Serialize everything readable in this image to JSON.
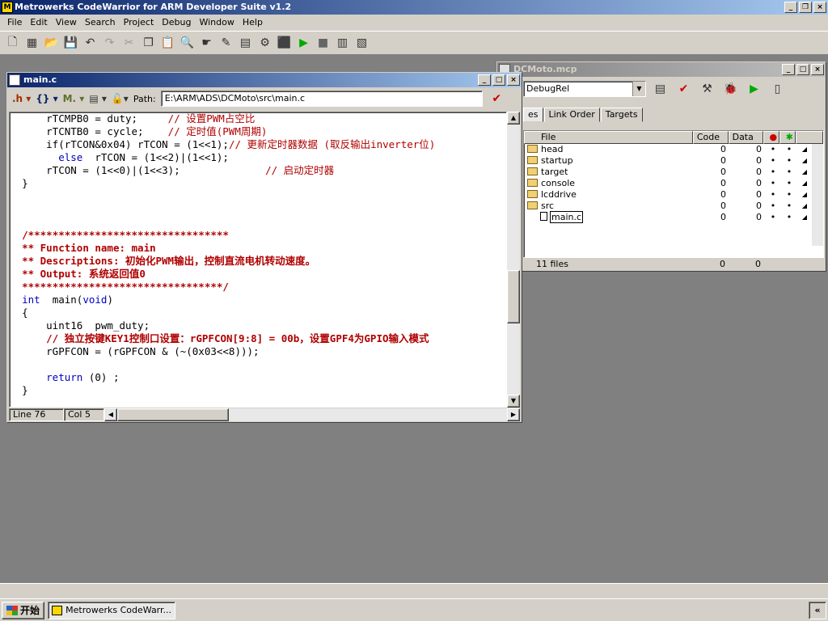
{
  "app": {
    "title": "Metrowerks CodeWarrior for ARM Developer Suite v1.2"
  },
  "menu": [
    "File",
    "Edit",
    "View",
    "Search",
    "Project",
    "Debug",
    "Window",
    "Help"
  ],
  "toolbar_icons": [
    "new-text-file-icon",
    "new-project-icon",
    "open-icon",
    "save-icon",
    "undo-icon",
    "redo-icon",
    "cut-icon",
    "copy-icon",
    "paste-icon",
    "find-icon",
    "find-next-icon",
    "replace-icon",
    "compile-icon",
    "project-settings-icon",
    "check-syntax-icon",
    "bring-up-to-date-icon",
    "debug-icon",
    "stop-icon",
    "preprocess-icon",
    "disassemble-icon"
  ],
  "project_window": {
    "title": "DCMoto.mcp",
    "target": "DebugRel",
    "tabs": [
      "es",
      "Link Order",
      "Targets"
    ],
    "columns": {
      "file": "File",
      "code": "Code",
      "data": "Data"
    },
    "files": [
      {
        "name": "head",
        "type": "folder",
        "code": "0",
        "data": "0",
        "debug": "•",
        "target": "•"
      },
      {
        "name": "startup",
        "type": "folder",
        "code": "0",
        "data": "0",
        "debug": "•",
        "target": "•"
      },
      {
        "name": "target",
        "type": "folder",
        "code": "0",
        "data": "0",
        "debug": "•",
        "target": "•"
      },
      {
        "name": "console",
        "type": "folder",
        "code": "0",
        "data": "0",
        "debug": "•",
        "target": "•"
      },
      {
        "name": "lcddrive",
        "type": "folder",
        "code": "0",
        "data": "0",
        "debug": "•",
        "target": "•"
      },
      {
        "name": "src",
        "type": "open-folder",
        "code": "0",
        "data": "0",
        "debug": "•",
        "target": "•"
      },
      {
        "name": "main.c",
        "type": "file",
        "code": "0",
        "data": "0",
        "debug": "•",
        "target": "•"
      }
    ],
    "status": {
      "count": "11 files",
      "code": "0",
      "data": "0"
    }
  },
  "editor": {
    "title": "main.c",
    "path_label": "Path:",
    "path": "E:\\ARM\\ADS\\DCMoto\\src\\main.c",
    "line": "Line 76",
    "col": "Col 5",
    "code_lines": [
      {
        "indent": 4,
        "parts": [
          {
            "t": "rTCMPB0 = duty;     ",
            "c": ""
          },
          {
            "t": "// 设置PWM占空比",
            "c": "cm"
          }
        ]
      },
      {
        "indent": 4,
        "parts": [
          {
            "t": "rTCNTB0 = cycle;    ",
            "c": ""
          },
          {
            "t": "// 定时值(PWM周期)",
            "c": "cm"
          }
        ]
      },
      {
        "indent": 4,
        "parts": [
          {
            "t": "if(rTCON&0x04) rTCON = (1<<1);",
            "c": ""
          },
          {
            "t": "// 更新定时器数据 (取反输出inverter位)",
            "c": "cm"
          }
        ]
      },
      {
        "indent": 6,
        "parts": [
          {
            "t": "else",
            "c": "kw"
          },
          {
            "t": "  rTCON = (1<<2)|(1<<1);",
            "c": ""
          }
        ]
      },
      {
        "indent": 4,
        "parts": [
          {
            "t": "rTCON = (1<<0)|(1<<3);              ",
            "c": ""
          },
          {
            "t": "// 启动定时器",
            "c": "cm"
          }
        ]
      },
      {
        "indent": 0,
        "parts": [
          {
            "t": "}",
            "c": ""
          }
        ]
      },
      {
        "indent": 0,
        "parts": []
      },
      {
        "indent": 0,
        "parts": []
      },
      {
        "indent": 0,
        "parts": []
      },
      {
        "indent": 0,
        "parts": [
          {
            "t": "/*********************************",
            "c": "cmbold"
          }
        ]
      },
      {
        "indent": 0,
        "parts": [
          {
            "t": "** Function name: main",
            "c": "cmbold"
          }
        ]
      },
      {
        "indent": 0,
        "parts": [
          {
            "t": "** Descriptions: 初始化PWM输出，控制直流电机转动速度。",
            "c": "cmbold"
          }
        ]
      },
      {
        "indent": 0,
        "parts": [
          {
            "t": "** Output: 系统返回值0",
            "c": "cmbold"
          }
        ]
      },
      {
        "indent": 0,
        "parts": [
          {
            "t": "*********************************/",
            "c": "cmbold"
          }
        ]
      },
      {
        "indent": 0,
        "parts": [
          {
            "t": "int",
            "c": "kw"
          },
          {
            "t": "  main(",
            "c": ""
          },
          {
            "t": "void",
            "c": "kw"
          },
          {
            "t": ")",
            "c": ""
          }
        ]
      },
      {
        "indent": 0,
        "parts": [
          {
            "t": "{",
            "c": ""
          }
        ]
      },
      {
        "indent": 4,
        "parts": [
          {
            "t": "uint16  pwm_duty;",
            "c": ""
          }
        ]
      },
      {
        "indent": 4,
        "parts": [
          {
            "t": "// 独立按键KEY1控制口设置：rGPFCON[9:8] = 00b，设置GPF4为GPIO输入模式",
            "c": "cmbold"
          }
        ]
      },
      {
        "indent": 4,
        "parts": [
          {
            "t": "rGPFCON = (rGPFCON & (~(0x03<<8)));",
            "c": ""
          }
        ]
      },
      {
        "indent": 0,
        "parts": []
      },
      {
        "indent": 4,
        "parts": [
          {
            "t": "return",
            "c": "kw"
          },
          {
            "t": " (0) ;",
            "c": ""
          }
        ]
      },
      {
        "indent": 0,
        "parts": [
          {
            "t": "}",
            "c": ""
          }
        ]
      }
    ]
  },
  "taskbar": {
    "start": "开始",
    "task": "Metrowerks CodeWarr...",
    "tray": "«"
  }
}
